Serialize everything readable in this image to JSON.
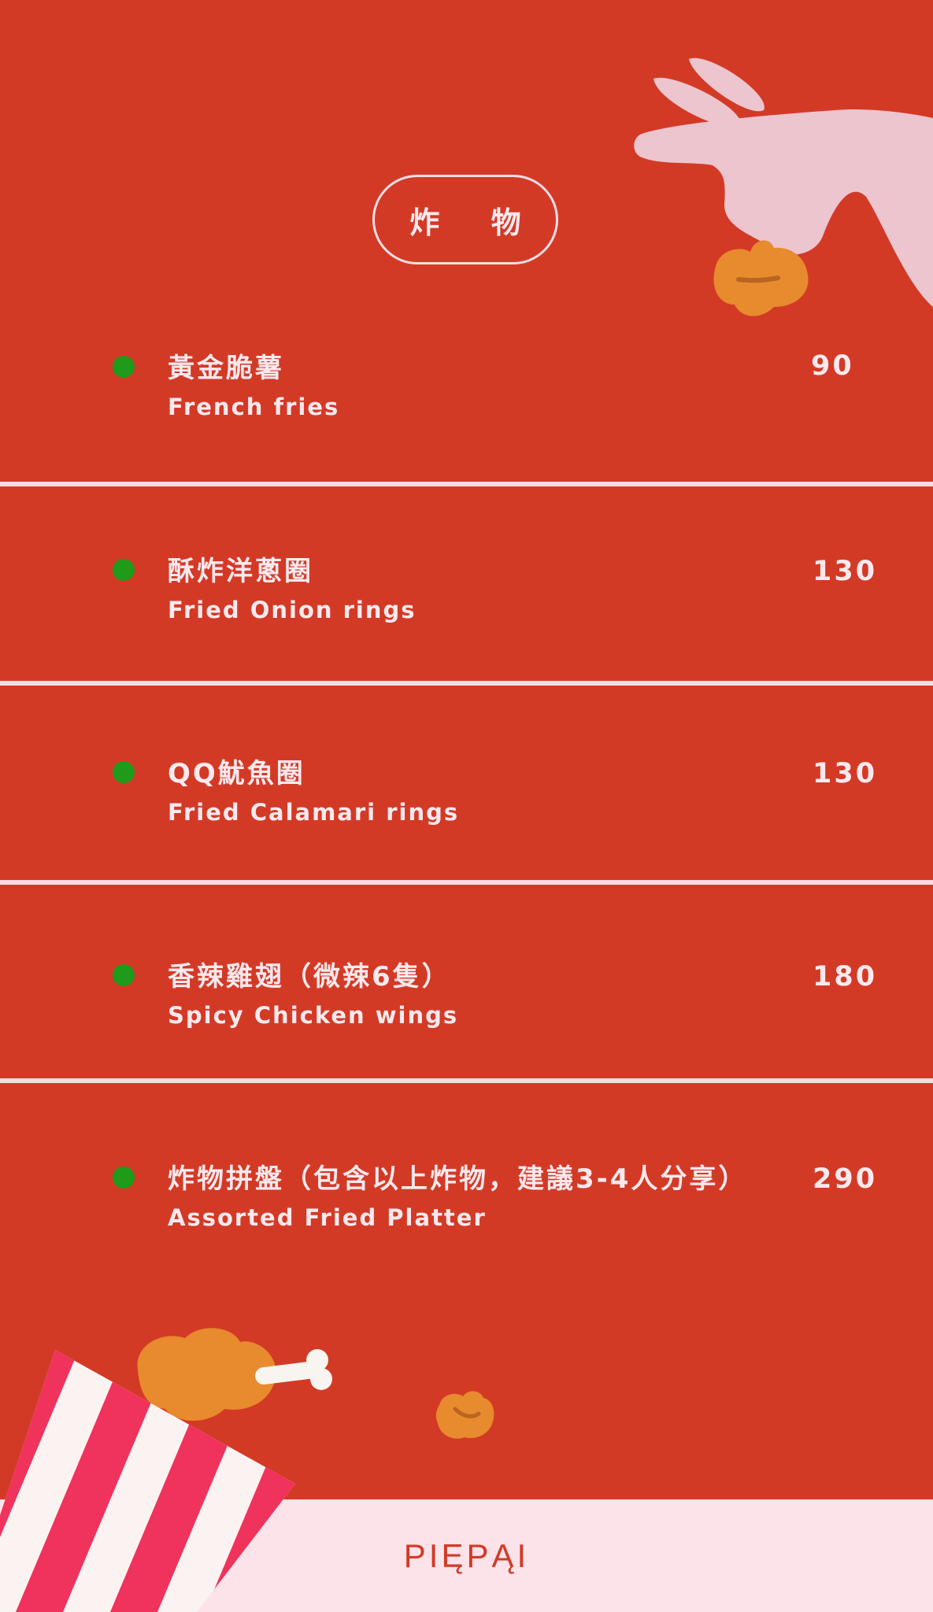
{
  "header": {
    "title": "炸 物"
  },
  "menu": {
    "items": [
      {
        "zh": "黃金脆薯",
        "en": "French fries",
        "price": "90"
      },
      {
        "zh": "酥炸洋蔥圈",
        "en": "Fried Onion rings",
        "price": "130"
      },
      {
        "zh": "QQ魷魚圈",
        "en": "Fried Calamari rings",
        "price": "130"
      },
      {
        "zh": "香辣雞翅（微辣6隻）",
        "en": "Spicy Chicken wings",
        "price": "180"
      },
      {
        "zh": "炸物拼盤（包含以上炸物，建議3-4人分享）",
        "en": "Assorted Fried Platter",
        "price": "290"
      }
    ]
  },
  "footer": {
    "brand": "PIĘPĄI"
  },
  "colors": {
    "background": "#d33a26",
    "text": "#fbe9ee",
    "dot": "#1f9a1b",
    "footer": "#fbe3e9"
  },
  "icons": [
    "hand-icon",
    "nugget-icon",
    "popcorn-bucket-icon",
    "chicken-drumstick-icon"
  ]
}
